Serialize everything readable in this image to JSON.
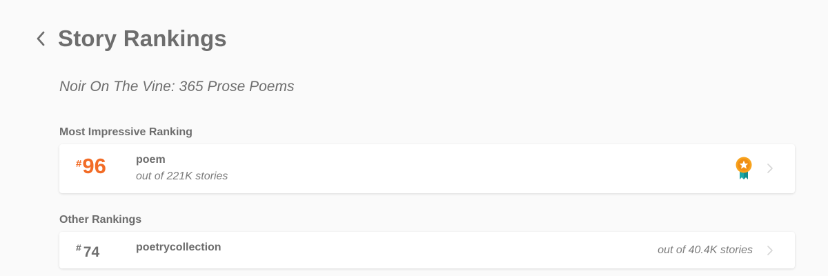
{
  "header": {
    "back_icon": "chevron-left-icon",
    "title": "Story Rankings"
  },
  "story": {
    "title": "Noir On The Vine: 365 Prose Poems"
  },
  "most_impressive": {
    "section_label": "Most Impressive Ranking",
    "hash": "#",
    "rank": "96",
    "tag": "poem",
    "out_of": "out of 221K stories",
    "badge_icon": "award-ribbon-icon",
    "accent_color": "#f26c27"
  },
  "other": {
    "section_label": "Other Rankings",
    "items": [
      {
        "hash": "#",
        "rank": "74",
        "tag": "poetrycollection",
        "out_of": "out of 40.4K stories"
      }
    ]
  }
}
